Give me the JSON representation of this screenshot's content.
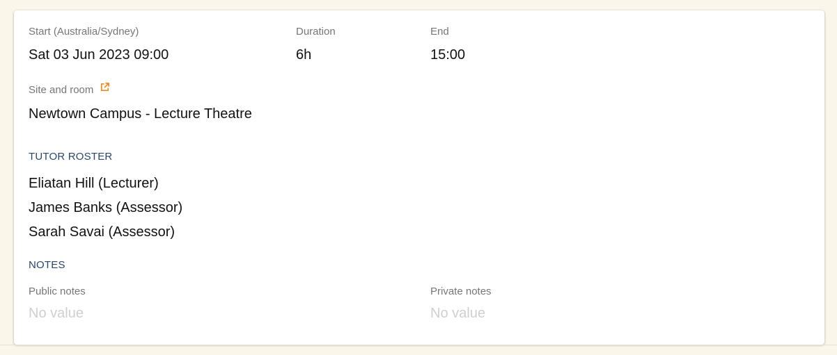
{
  "schedule": {
    "start_label": "Start (Australia/Sydney)",
    "start_value": "Sat 03 Jun 2023 09:00",
    "duration_label": "Duration",
    "duration_value": "6h",
    "end_label": "End",
    "end_value": "15:00"
  },
  "site": {
    "label": "Site and room",
    "value": "Newtown Campus - Lecture Theatre",
    "link_icon": "external-link-icon",
    "link_color": "#f08a24"
  },
  "roster": {
    "heading": "TUTOR ROSTER",
    "tutors": [
      "Eliatan Hill (Lecturer)",
      "James Banks (Assessor)",
      "Sarah Savai (Assessor)"
    ]
  },
  "notes": {
    "heading": "NOTES",
    "public_label": "Public notes",
    "public_value": "No value",
    "private_label": "Private notes",
    "private_value": "No value"
  },
  "colors": {
    "page_background": "#faf7ea",
    "heading": "#2b4569",
    "placeholder": "#cfcfcf"
  }
}
